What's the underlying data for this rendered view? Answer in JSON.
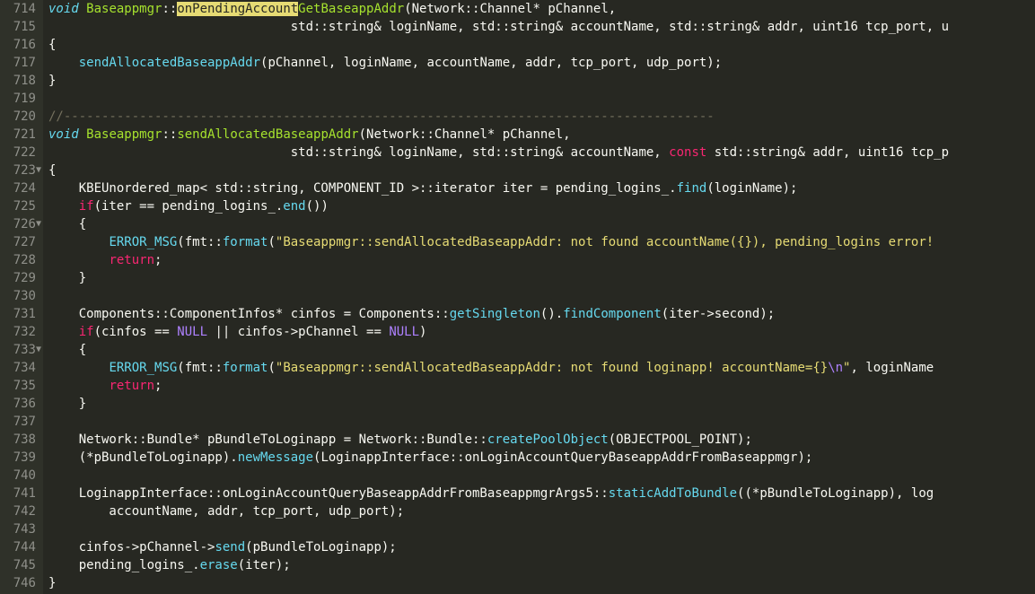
{
  "lines": [
    {
      "num": 714,
      "fold": false,
      "tokens": [
        {
          "t": "void",
          "c": "c-kw"
        },
        {
          "t": " "
        },
        {
          "t": "Baseappmgr",
          "c": "c-type"
        },
        {
          "t": "::"
        },
        {
          "t": "onPendingAccount",
          "c": "c-sel"
        },
        {
          "t": "GetBaseappAddr",
          "c": "c-func"
        },
        {
          "t": "(Network::Channel* pChannel,"
        }
      ]
    },
    {
      "num": 715,
      "fold": false,
      "tokens": [
        {
          "t": "                                std::string& loginName, std::string& accountName, std::string& addr, uint16 tcp_port, u"
        }
      ]
    },
    {
      "num": 716,
      "fold": false,
      "tokens": [
        {
          "t": "{"
        }
      ]
    },
    {
      "num": 717,
      "fold": false,
      "tokens": [
        {
          "t": "    "
        },
        {
          "t": "sendAllocatedBaseappAddr",
          "c": "c-call"
        },
        {
          "t": "(pChannel, loginName, accountName, addr, tcp_port, udp_port);"
        }
      ]
    },
    {
      "num": 718,
      "fold": false,
      "tokens": [
        {
          "t": "}"
        }
      ]
    },
    {
      "num": 719,
      "fold": false,
      "tokens": []
    },
    {
      "num": 720,
      "fold": false,
      "tokens": [
        {
          "t": "//--------------------------------------------------------------------------------------",
          "c": "c-cm"
        }
      ]
    },
    {
      "num": 721,
      "fold": false,
      "tokens": [
        {
          "t": "void",
          "c": "c-kw"
        },
        {
          "t": " "
        },
        {
          "t": "Baseappmgr",
          "c": "c-type"
        },
        {
          "t": "::"
        },
        {
          "t": "sendAllocatedBaseappAddr",
          "c": "c-func"
        },
        {
          "t": "(Network::Channel* pChannel,"
        }
      ]
    },
    {
      "num": 722,
      "fold": false,
      "tokens": [
        {
          "t": "                                std::string& loginName, std::string& accountName, "
        },
        {
          "t": "const",
          "c": "c-kw2"
        },
        {
          "t": " std::string& addr, uint16 tcp_p"
        }
      ]
    },
    {
      "num": 723,
      "fold": true,
      "tokens": [
        {
          "t": "{"
        }
      ]
    },
    {
      "num": 724,
      "fold": false,
      "tokens": [
        {
          "t": "    KBEUnordered_map< std::string, COMPONENT_ID >::iterator iter = pending_logins_."
        },
        {
          "t": "find",
          "c": "c-call"
        },
        {
          "t": "(loginName);"
        }
      ]
    },
    {
      "num": 725,
      "fold": false,
      "tokens": [
        {
          "t": "    "
        },
        {
          "t": "if",
          "c": "c-kw2"
        },
        {
          "t": "(iter == pending_logins_."
        },
        {
          "t": "end",
          "c": "c-call"
        },
        {
          "t": "())"
        }
      ]
    },
    {
      "num": 726,
      "fold": true,
      "tokens": [
        {
          "t": "    {"
        }
      ]
    },
    {
      "num": 727,
      "fold": false,
      "tokens": [
        {
          "t": "        "
        },
        {
          "t": "ERROR_MSG",
          "c": "c-call"
        },
        {
          "t": "(fmt::"
        },
        {
          "t": "format",
          "c": "c-call"
        },
        {
          "t": "("
        },
        {
          "t": "\"Baseappmgr::sendAllocatedBaseappAddr: not found accountName({}), pending_logins error!",
          "c": "c-str"
        }
      ]
    },
    {
      "num": 728,
      "fold": false,
      "tokens": [
        {
          "t": "        "
        },
        {
          "t": "return",
          "c": "c-kw2"
        },
        {
          "t": ";"
        }
      ]
    },
    {
      "num": 729,
      "fold": false,
      "tokens": [
        {
          "t": "    }"
        }
      ]
    },
    {
      "num": 730,
      "fold": false,
      "tokens": []
    },
    {
      "num": 731,
      "fold": false,
      "tokens": [
        {
          "t": "    Components::ComponentInfos* cinfos = Components::"
        },
        {
          "t": "getSingleton",
          "c": "c-call"
        },
        {
          "t": "()."
        },
        {
          "t": "findComponent",
          "c": "c-call"
        },
        {
          "t": "(iter->second);"
        }
      ]
    },
    {
      "num": 732,
      "fold": false,
      "tokens": [
        {
          "t": "    "
        },
        {
          "t": "if",
          "c": "c-kw2"
        },
        {
          "t": "(cinfos == "
        },
        {
          "t": "NULL",
          "c": "c-const"
        },
        {
          "t": " || cinfos->pChannel == "
        },
        {
          "t": "NULL",
          "c": "c-const"
        },
        {
          "t": ")"
        }
      ]
    },
    {
      "num": 733,
      "fold": true,
      "tokens": [
        {
          "t": "    {"
        }
      ]
    },
    {
      "num": 734,
      "fold": false,
      "tokens": [
        {
          "t": "        "
        },
        {
          "t": "ERROR_MSG",
          "c": "c-call"
        },
        {
          "t": "(fmt::"
        },
        {
          "t": "format",
          "c": "c-call"
        },
        {
          "t": "("
        },
        {
          "t": "\"Baseappmgr::sendAllocatedBaseappAddr: not found loginapp! accountName={}",
          "c": "c-str"
        },
        {
          "t": "\\n",
          "c": "c-esc"
        },
        {
          "t": "\"",
          "c": "c-str"
        },
        {
          "t": ", loginName"
        }
      ]
    },
    {
      "num": 735,
      "fold": false,
      "tokens": [
        {
          "t": "        "
        },
        {
          "t": "return",
          "c": "c-kw2"
        },
        {
          "t": ";"
        }
      ]
    },
    {
      "num": 736,
      "fold": false,
      "tokens": [
        {
          "t": "    }"
        }
      ]
    },
    {
      "num": 737,
      "fold": false,
      "tokens": []
    },
    {
      "num": 738,
      "fold": false,
      "tokens": [
        {
          "t": "    Network::Bundle* pBundleToLoginapp = Network::Bundle::"
        },
        {
          "t": "createPoolObject",
          "c": "c-call"
        },
        {
          "t": "(OBJECTPOOL_POINT);"
        }
      ]
    },
    {
      "num": 739,
      "fold": false,
      "tokens": [
        {
          "t": "    (*pBundleToLoginapp)."
        },
        {
          "t": "newMessage",
          "c": "c-call"
        },
        {
          "t": "(LoginappInterface::onLoginAccountQueryBaseappAddrFromBaseappmgr);"
        }
      ]
    },
    {
      "num": 740,
      "fold": false,
      "tokens": []
    },
    {
      "num": 741,
      "fold": false,
      "tokens": [
        {
          "t": "    LoginappInterface::onLoginAccountQueryBaseappAddrFromBaseappmgrArgs5::"
        },
        {
          "t": "staticAddToBundle",
          "c": "c-call"
        },
        {
          "t": "((*pBundleToLoginapp), log"
        }
      ]
    },
    {
      "num": 742,
      "fold": false,
      "tokens": [
        {
          "t": "        accountName, addr, tcp_port, udp_port);"
        }
      ]
    },
    {
      "num": 743,
      "fold": false,
      "tokens": []
    },
    {
      "num": 744,
      "fold": false,
      "tokens": [
        {
          "t": "    cinfos->pChannel->"
        },
        {
          "t": "send",
          "c": "c-call"
        },
        {
          "t": "(pBundleToLoginapp);"
        }
      ]
    },
    {
      "num": 745,
      "fold": false,
      "tokens": [
        {
          "t": "    pending_logins_."
        },
        {
          "t": "erase",
          "c": "c-call"
        },
        {
          "t": "(iter);"
        }
      ]
    },
    {
      "num": 746,
      "fold": false,
      "tokens": [
        {
          "t": "}"
        }
      ]
    }
  ]
}
